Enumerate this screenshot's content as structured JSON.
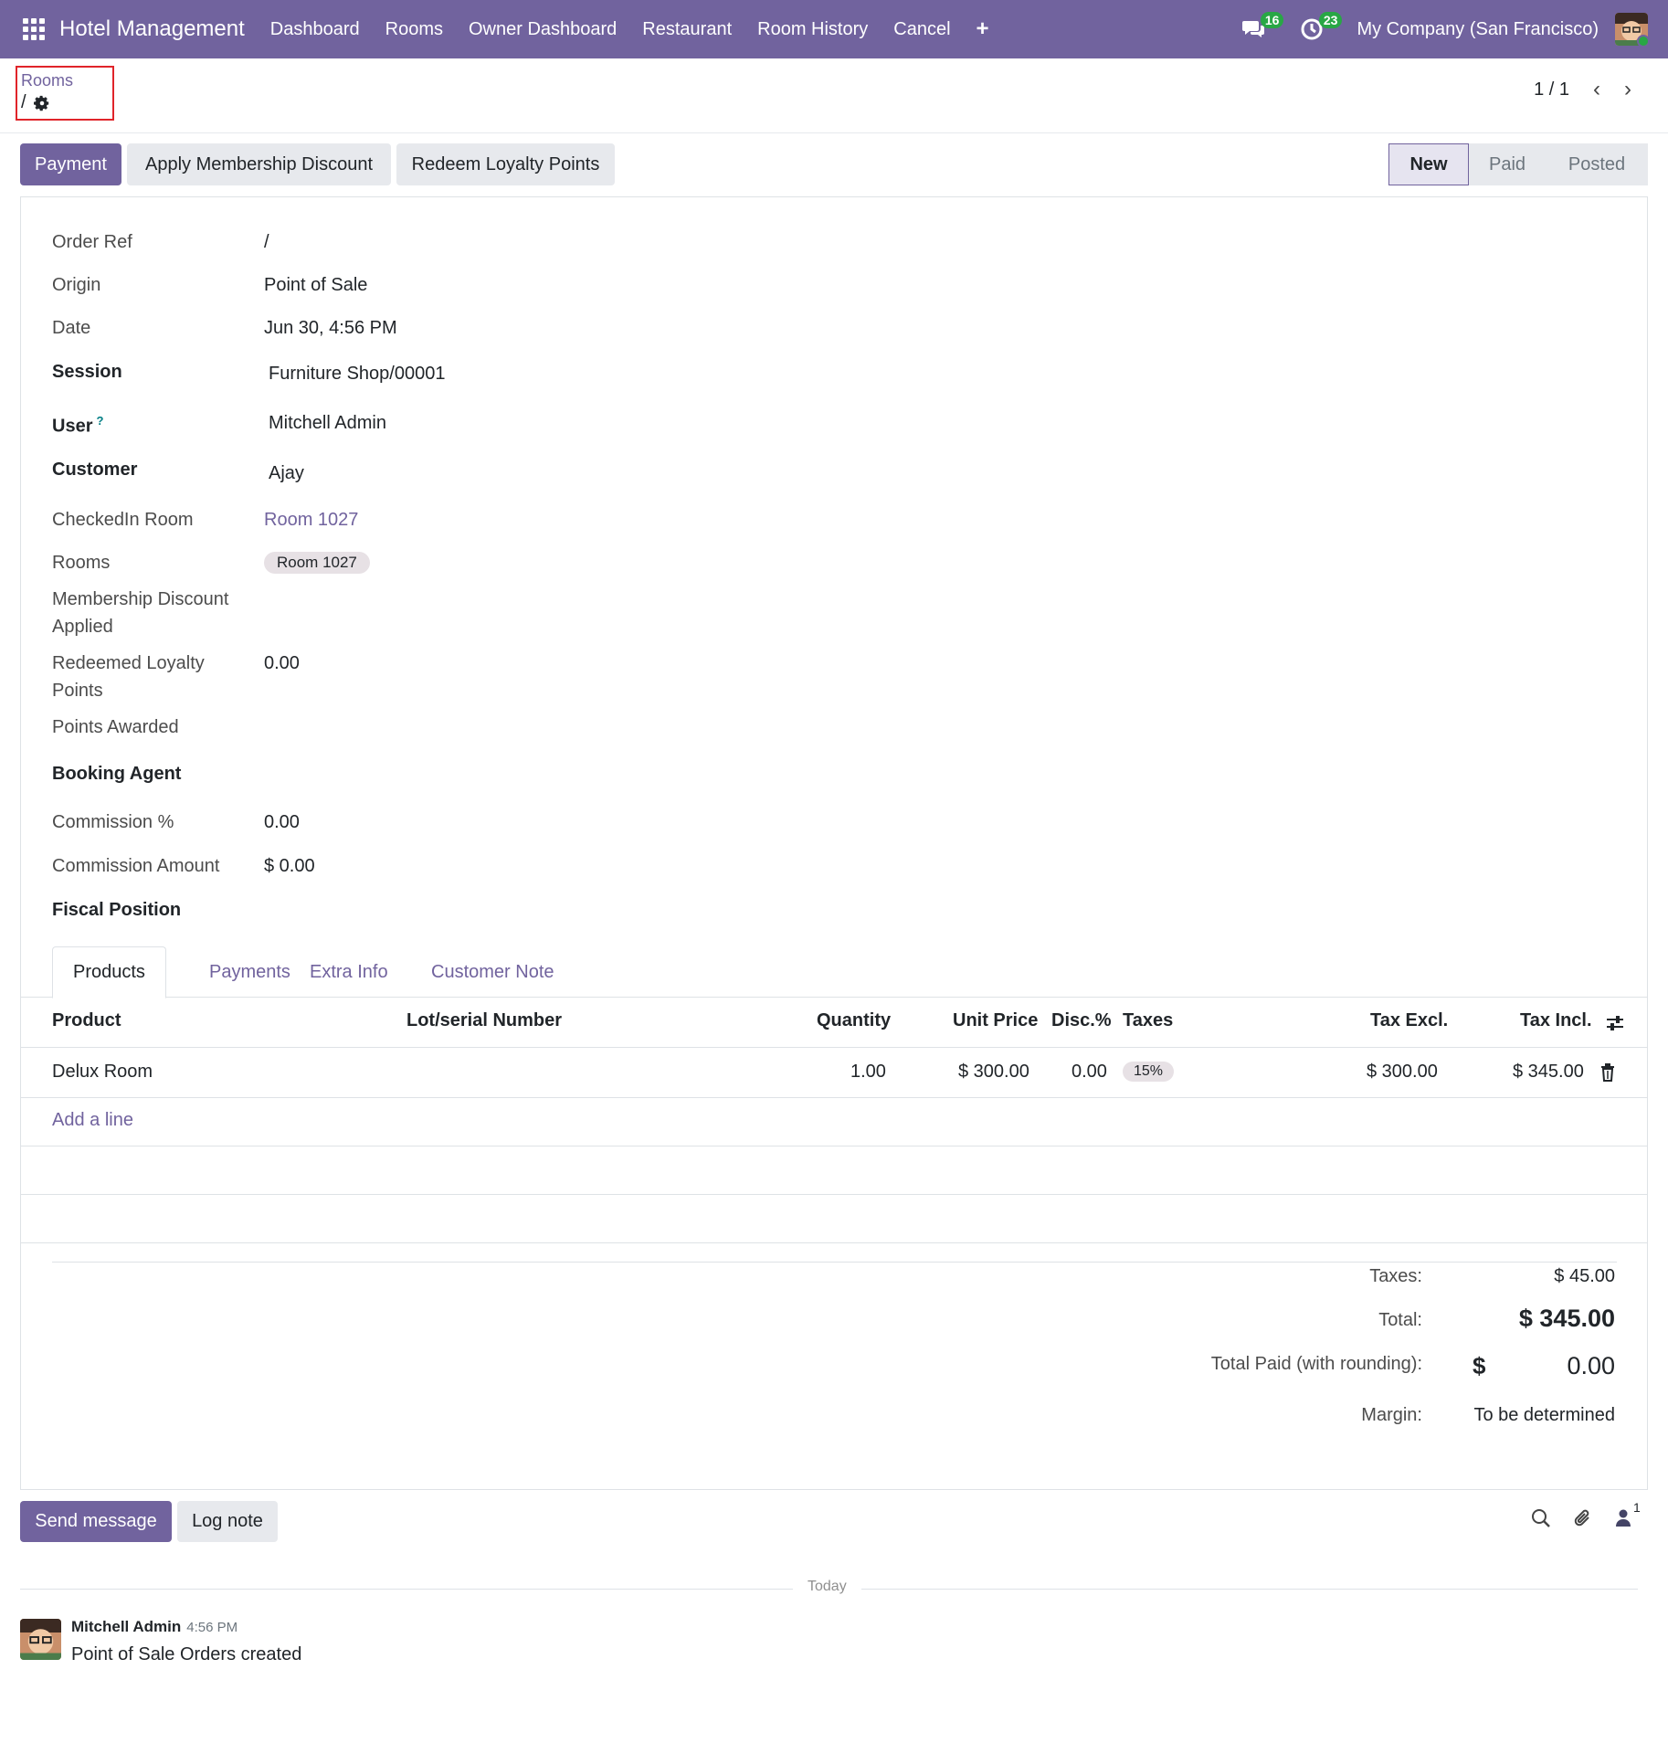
{
  "navbar": {
    "app_title": "Hotel Management",
    "menu": [
      "Dashboard",
      "Rooms",
      "Owner Dashboard",
      "Restaurant",
      "Room History",
      "Cancel"
    ],
    "plus": "+",
    "messages_count": "16",
    "activities_count": "23",
    "company": "My Company (San Francisco)"
  },
  "breadcrumb": {
    "parent": "Rooms",
    "current": "/"
  },
  "pager": {
    "value": "1 / 1"
  },
  "actions": {
    "payment": "Payment",
    "membership": "Apply Membership Discount",
    "loyalty": "Redeem Loyalty Points"
  },
  "status": {
    "stages": [
      "New",
      "Paid",
      "Posted"
    ],
    "active": "New"
  },
  "form": {
    "order_ref_label": "Order Ref",
    "order_ref": "/",
    "origin_label": "Origin",
    "origin": "Point of Sale",
    "date_label": "Date",
    "date": "Jun 30, 4:56 PM",
    "session_label": "Session",
    "session": "Furniture Shop/00001",
    "user_label": "User",
    "user_help": "?",
    "user": "Mitchell Admin",
    "customer_label": "Customer",
    "customer": "Ajay",
    "checkedin_label": "CheckedIn Room",
    "checkedin": "Room 1027",
    "rooms_label": "Rooms",
    "rooms_tag": "Room 1027",
    "membership_label": "Membership Discount Applied",
    "redeemed_label": "Redeemed Loyalty Points",
    "redeemed": "0.00",
    "points_label": "Points Awarded",
    "booking_agent_label": "Booking Agent",
    "commission_pct_label": "Commission %",
    "commission_pct": "0.00",
    "commission_amt_label": "Commission Amount",
    "commission_amt": "$ 0.00",
    "fiscal_label": "Fiscal Position"
  },
  "tabs": [
    "Products",
    "Payments",
    "Extra Info",
    "Customer Note"
  ],
  "table": {
    "headers": {
      "product": "Product",
      "lot": "Lot/serial Number",
      "qty": "Quantity",
      "unit_price": "Unit Price",
      "disc": "Disc.%",
      "taxes": "Taxes",
      "tax_excl": "Tax Excl.",
      "tax_incl": "Tax Incl."
    },
    "rows": [
      {
        "product": "Delux Room",
        "qty": "1.00",
        "unit_price": "$ 300.00",
        "disc": "0.00",
        "tax": "15%",
        "tax_excl": "$ 300.00",
        "tax_incl": "$ 345.00"
      }
    ],
    "add_line": "Add a line"
  },
  "totals": {
    "taxes_label": "Taxes:",
    "taxes": "$ 45.00",
    "total_label": "Total:",
    "total": "$ 345.00",
    "paid_label": "Total Paid (with rounding):",
    "paid_currency": "$",
    "paid": "0.00",
    "margin_label": "Margin:",
    "margin": "To be determined"
  },
  "chatter": {
    "send_message": "Send message",
    "log_note": "Log note",
    "followers_count": "1",
    "today": "Today",
    "author": "Mitchell Admin",
    "time": "4:56 PM",
    "body": "Point of Sale Orders created"
  },
  "colors": {
    "brand": "#71639e",
    "badge": "#28a745",
    "highlight_border": "#e0242a"
  }
}
